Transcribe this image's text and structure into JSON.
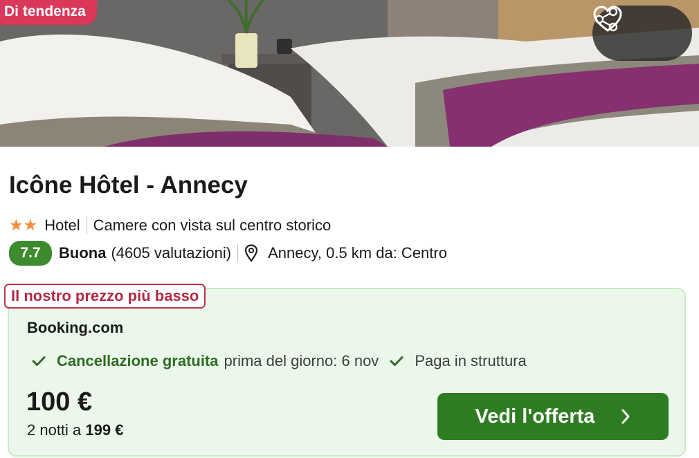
{
  "hero": {
    "badge": "Di tendenza",
    "share_icon": "share-icon",
    "favorite_icon": "heart-icon"
  },
  "hotel": {
    "name": "Icône Hôtel - Annecy",
    "stars": "★★",
    "type": "Hotel",
    "highlight": "Camere con vista sul centro storico",
    "score": "7.7",
    "rating_word": "Buona",
    "reviews": "(4605 valutazioni)",
    "location": "Annecy, 0.5 km da: Centro"
  },
  "offer": {
    "tag": "Il nostro prezzo più basso",
    "provider": "Booking.com",
    "perk1_strong": "Cancellazione gratuita",
    "perk1_text": "prima del giorno: 6 nov",
    "perk2_text": "Paga in struttura",
    "price": "100 €",
    "nights_prefix": "2 notti a",
    "nights_total": "199 €",
    "cta": "Vedi l'offerta"
  },
  "colors": {
    "badge": "#d9385a",
    "score": "#3d8b2e",
    "cta": "#2f7d22",
    "offer_bg": "#ebf7ea",
    "tag_border": "#c0334c",
    "stars": "#f08c3a"
  }
}
